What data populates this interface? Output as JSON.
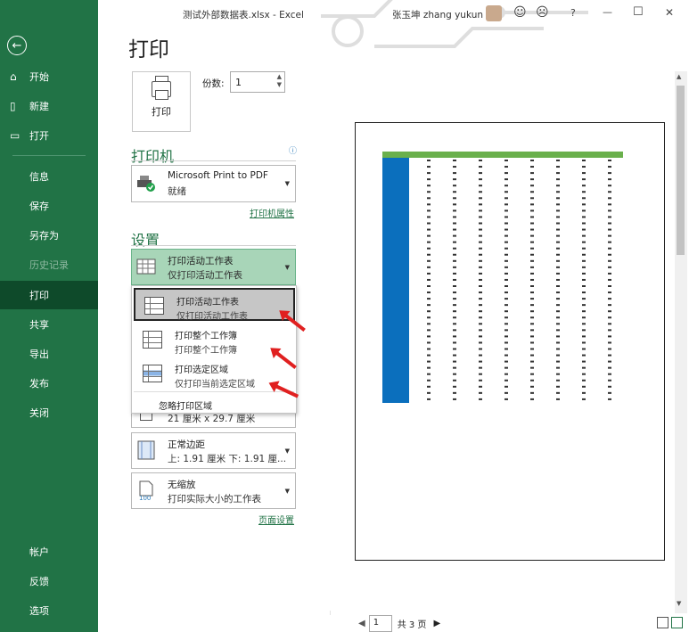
{
  "window": {
    "doc_title": "测试外部数据表.xlsx  -  Excel",
    "user": "张玉坤 zhang yukun",
    "controls": [
      "☺",
      "☹",
      "?",
      "—",
      "☐",
      "✕"
    ]
  },
  "sidebar": {
    "back": "←",
    "items": [
      {
        "label": "开始",
        "icon": "⌂"
      },
      {
        "label": "新建",
        "icon": "▯"
      },
      {
        "label": "打开",
        "icon": "▭"
      },
      {
        "label": "信息"
      },
      {
        "label": "保存"
      },
      {
        "label": "另存为"
      },
      {
        "label": "历史记录"
      },
      {
        "label": "打印"
      },
      {
        "label": "共享"
      },
      {
        "label": "导出"
      },
      {
        "label": "发布"
      },
      {
        "label": "关闭"
      },
      {
        "label": "帐户"
      },
      {
        "label": "反馈"
      },
      {
        "label": "选项"
      }
    ]
  },
  "main": {
    "title": "打印",
    "print_button": "打印",
    "copies_label": "份数:",
    "copies_value": "1",
    "printer_section": "打印机",
    "printer_name": "Microsoft Print to PDF",
    "printer_status": "就绪",
    "printer_props_link": "打印机属性",
    "settings_section": "设置",
    "what_dd": {
      "title": "打印活动工作表",
      "sub": "仅打印活动工作表"
    },
    "popup_options": [
      {
        "title": "打印活动工作表",
        "sub": "仅打印活动工作表"
      },
      {
        "title": "打印整个工作簿",
        "sub": "打印整个工作簿"
      },
      {
        "title": "打印选定区域",
        "sub": "仅打印当前选定区域"
      }
    ],
    "ignore_area": "忽略打印区域",
    "paper_partial": "21 厘米 x 29.7 厘米",
    "margins_dd": {
      "title": "正常边距",
      "sub": "上: 1.91 厘米 下: 1.91 厘..."
    },
    "scale_dd": {
      "title": "无缩放",
      "sub": "打印实际大小的工作表"
    },
    "page_setup_link": "页面设置"
  },
  "preview": {
    "page_input": "1",
    "page_total": "共 3 页"
  }
}
